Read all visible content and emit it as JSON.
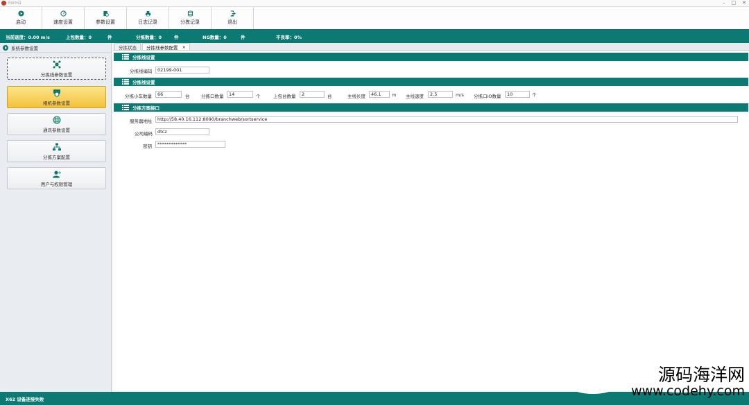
{
  "window": {
    "title": "Form1"
  },
  "toolbar": {
    "buttons": [
      {
        "label": "启动",
        "icon": "play-icon"
      },
      {
        "label": "速度设置",
        "icon": "speed-icon"
      },
      {
        "label": "参数设置",
        "icon": "gear-doc-icon"
      },
      {
        "label": "日志记录",
        "icon": "printer-icon"
      },
      {
        "label": "分拣记录",
        "icon": "database-icon"
      },
      {
        "label": "退出",
        "icon": "exit-icon"
      }
    ]
  },
  "status": {
    "speed": "当前速度：0.00  m/s",
    "upload": "上包数量：0",
    "upload_unit": "件",
    "sorted": "分拣数量：0",
    "sorted_unit": "件",
    "ng": "NG数量：0",
    "ng_unit": "件",
    "rate": "不良率：0%"
  },
  "sidebar": {
    "header": "系统参数设置",
    "items": [
      {
        "label": "分拣线参数设置",
        "icon": "network-icon"
      },
      {
        "label": "相机参数设置",
        "icon": "camera-icon"
      },
      {
        "label": "通讯参数设置",
        "icon": "globe-icon"
      },
      {
        "label": "分拣方案配置",
        "icon": "flow-icon"
      },
      {
        "label": "用户与权限管理",
        "icon": "user-icon"
      }
    ]
  },
  "tabs": [
    {
      "label": "分拣状态"
    },
    {
      "label": "分拣线参数配置",
      "close": "×"
    }
  ],
  "sections": {
    "line_settings": {
      "title": "分拣线设置",
      "line_code_label": "分拣线编码",
      "line_code_value": "02199-001"
    },
    "line_params": {
      "title": "分拣线设置",
      "cart_count_label": "分拣小车数量",
      "cart_count_value": "66",
      "cart_count_unit": "台",
      "outlet_count_label": "分拣口数量",
      "outlet_count_value": "14",
      "outlet_count_unit": "个",
      "upload_count_label": "上包台数量",
      "upload_count_value": "2",
      "upload_count_unit": "台",
      "line_length_label": "主线长度",
      "line_length_value": "46.1",
      "line_length_unit": "m",
      "line_speed_label": "主线速度",
      "line_speed_value": "2.5",
      "line_speed_unit": "m/s",
      "outlet_io_label": "分拣口IO数量",
      "outlet_io_value": "10",
      "outlet_io_unit": "个"
    },
    "plan_interface": {
      "title": "分拣方案接口",
      "server_label": "服务器地址",
      "server_value": "http://58.40.16.112:8090/branchweb/sortservice",
      "company_label": "公司编码",
      "company_value": "dtcz",
      "password_label": "密钥",
      "password_value": "*************"
    }
  },
  "bottom": {
    "text": "X62 设备连接失败"
  },
  "watermark": {
    "line1": "源码海洋网",
    "line2": "www.codehy.com"
  },
  "colors": {
    "accent": "#0c7a72",
    "active_nav": "#f3c23b"
  }
}
